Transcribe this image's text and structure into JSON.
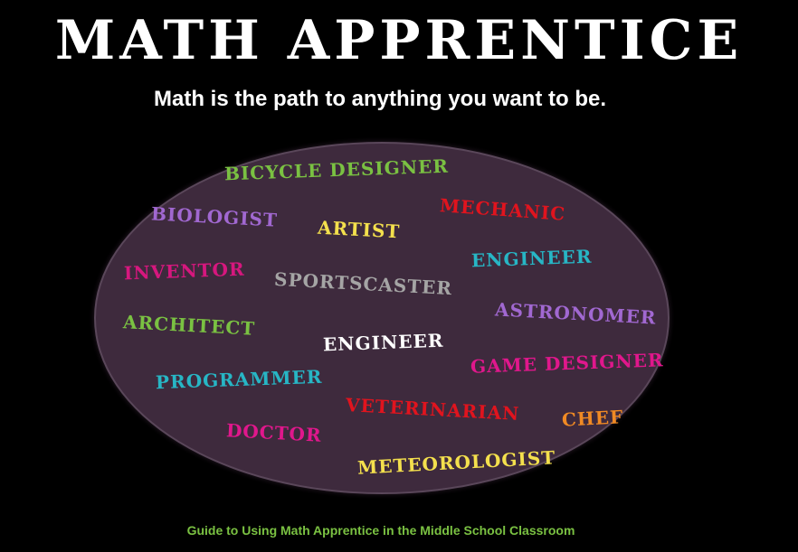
{
  "title": "MATH APPRENTICE",
  "subtitle": "Math is the path to anything you want to be.",
  "careers": [
    {
      "label": "BICYCLE DESIGNER",
      "color": "#7ac142"
    },
    {
      "label": "BIOLOGIST",
      "color": "#a168d1"
    },
    {
      "label": "ARTIST",
      "color": "#f4e04d"
    },
    {
      "label": "MECHANIC",
      "color": "#e0141e"
    },
    {
      "label": "INVENTOR",
      "color": "#d6177e"
    },
    {
      "label": "SPORTSCASTER",
      "color": "#a5a5a5"
    },
    {
      "label": "ENGINEER",
      "color": "#27b6c5"
    },
    {
      "label": "ASTRONOMER",
      "color": "#a168d1"
    },
    {
      "label": "ARCHITECT",
      "color": "#7ac142"
    },
    {
      "label": "ENGINEER",
      "color": "#ffffff"
    },
    {
      "label": "GAME DESIGNER",
      "color": "#e0178c"
    },
    {
      "label": "PROGRAMMER",
      "color": "#27b6c5"
    },
    {
      "label": "VETERINARIAN",
      "color": "#e0141e"
    },
    {
      "label": "CHEF",
      "color": "#f08a24"
    },
    {
      "label": "DOCTOR",
      "color": "#e0178c"
    },
    {
      "label": "METEOROLOGIST",
      "color": "#f4e04d"
    }
  ],
  "footer": "Guide to Using Math Apprentice in the Middle School Classroom"
}
